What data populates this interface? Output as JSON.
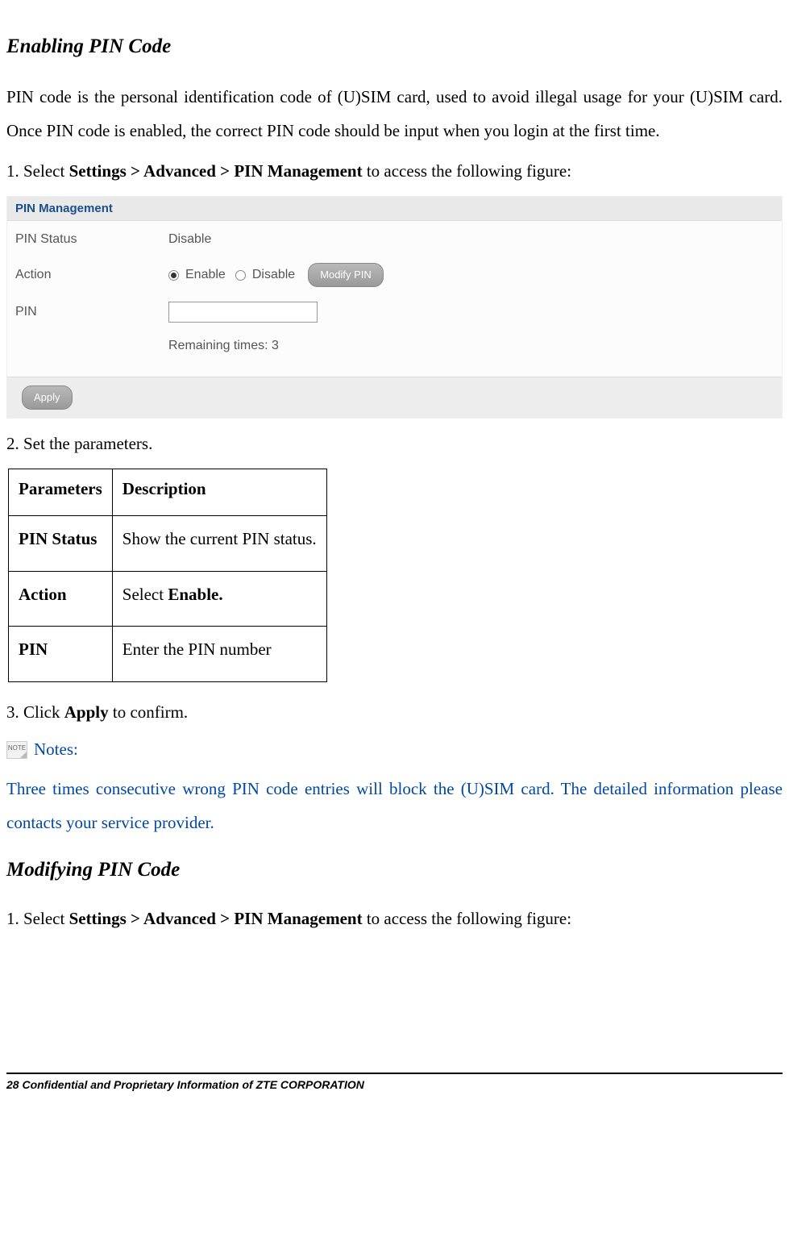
{
  "section1": {
    "title": "Enabling PIN Code",
    "intro": "PIN code is the personal identification code of (U)SIM card, used to avoid illegal usage for your (U)SIM card. Once PIN code is enabled, the correct PIN code should be input when you login at the first time.",
    "step1_prefix": "1. Select ",
    "step1_bold": "Settings > Advanced > PIN Management",
    "step1_suffix": " to access the following figure:"
  },
  "panel": {
    "title": "PIN Management",
    "labels": {
      "pin_status": "PIN Status",
      "action": "Action",
      "pin": "PIN"
    },
    "values": {
      "pin_status": "Disable",
      "enable": "Enable",
      "disable": "Disable",
      "modify_btn": "Modify PIN",
      "remaining": "Remaining times: 3"
    },
    "apply_btn": "Apply"
  },
  "step2": "2. Set the parameters.",
  "table": {
    "h1": "Parameters",
    "h2": "Description",
    "rows": [
      {
        "p": "PIN Status",
        "d_plain": "Show the current PIN status."
      },
      {
        "p": "Action",
        "d_prefix": "Select ",
        "d_bold": "Enable."
      },
      {
        "p": "PIN",
        "d_plain": "Enter the PIN number"
      }
    ]
  },
  "step3": {
    "prefix": "3. Click ",
    "bold": "Apply",
    "suffix": " to confirm."
  },
  "note": {
    "icon_text": "NOTE",
    "label": "Notes:",
    "text": "Three times consecutive wrong PIN code entries will block the (U)SIM card. The detailed information please contacts your service provider."
  },
  "section2": {
    "title": "Modifying PIN Code",
    "step1_prefix": "1. Select ",
    "step1_bold": "Settings > Advanced > PIN Management",
    "step1_suffix": " to access the following figure:"
  },
  "footer": "28 Confidential and Proprietary Information of ZTE CORPORATION"
}
